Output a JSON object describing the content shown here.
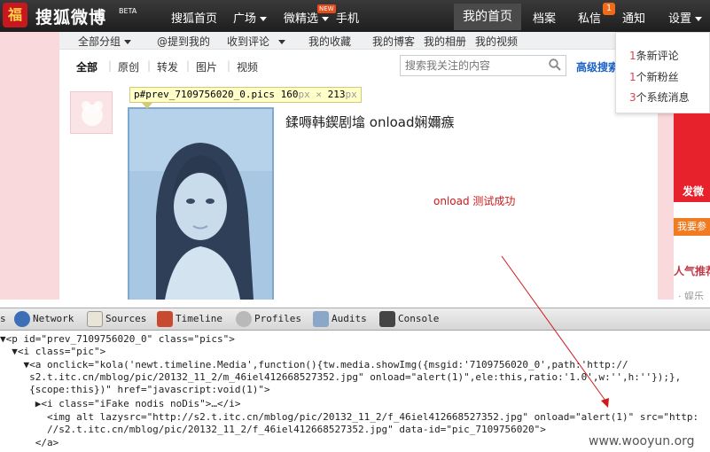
{
  "topbar": {
    "logo_badge": "福",
    "logo_text": "搜狐微博",
    "beta": "BETA",
    "nav": [
      "搜狐首页",
      "广场",
      "微精选",
      "手机"
    ],
    "new_badge": "NEW",
    "right_nav": [
      "我的首页",
      "档案",
      "私信",
      "通知",
      "设置"
    ],
    "dm_count": "1"
  },
  "subnav": {
    "items": [
      "全部分组",
      "@提到我的",
      "收到评论",
      "我的收藏",
      "我的博客",
      "我的相册",
      "我的视频"
    ]
  },
  "filters": {
    "items": [
      "全部",
      "原创",
      "转发",
      "图片",
      "视频"
    ],
    "search_placeholder": "搜索我关注的内容",
    "advanced_search": "高级搜索"
  },
  "notifications": {
    "items": [
      {
        "num": "1",
        "text": "条新评论"
      },
      {
        "num": "1",
        "text": "个新粉丝"
      },
      {
        "num": "3",
        "text": "个系统消息"
      }
    ]
  },
  "post": {
    "tooltip_selector": "p#prev_7109756020_0.pics",
    "tooltip_w": "160",
    "tooltip_h": "213",
    "tooltip_unit": "px",
    "tooltip_times": "×",
    "text": "鍒嗕韩鍥剧墖  onload娴嬭瘯",
    "onload_note": "onload 测试成功"
  },
  "rightcol": {
    "promo_text": "发微",
    "promo_btn": "我要参",
    "hot_title": "人气推荐",
    "hot_item": "· 娱乐"
  },
  "devtools": {
    "tabs": [
      "Network",
      "Sources",
      "Timeline",
      "Profiles",
      "Audits",
      "Console"
    ],
    "lines": [
      "▼<p id=\"prev_7109756020_0\" class=\"pics\">",
      "  ▼<i class=\"pic\">",
      "    ▼<a onclick=\"kola('newt.timeline.Media',function(){tw.media.showImg({msgid:'7109756020_0',path:'http://",
      "     s2.t.itc.cn/mblog/pic/20132_11_2/m_46iel412668527352.jpg\" onload=\"alert(1)\",ele:this,ratio:'1.0',w:'',h:''});},",
      "     {scope:this})\" href=\"javascript:void(1)\">",
      "      ▶<i class=\"iFake nodis noDis\">…</i>",
      "        <img alt lazysrc=\"http://s2.t.itc.cn/mblog/pic/20132_11_2/f_46iel412668527352.jpg\" onload=\"alert(1)\" src=\"http:",
      "        //s2.t.itc.cn/mblog/pic/20132_11_2/f_46iel412668527352.jpg\" data-id=\"pic_7109756020\">",
      "      </a>"
    ],
    "watermark": "www.wooyun.org"
  },
  "colors": {
    "accent_red": "#d0181a",
    "nav_bg": "#2b2b2b",
    "page_pink": "#f9d9dc",
    "link_blue": "#1a62c4"
  }
}
